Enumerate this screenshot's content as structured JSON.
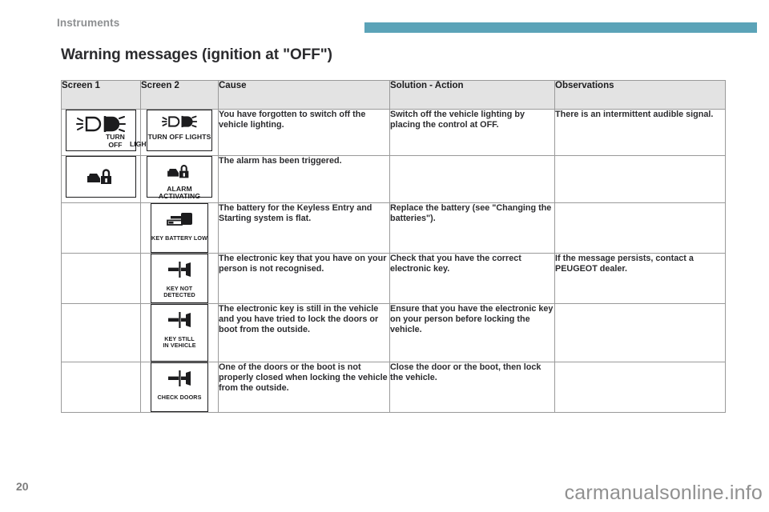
{
  "header": {
    "section_label": "Instruments",
    "accent_color": "#5ba3b8"
  },
  "page_title": "Warning messages (ignition at \"OFF\")",
  "table": {
    "columns": [
      "Screen 1",
      "Screen 2",
      "Cause",
      "Solution - Action",
      "Observations"
    ],
    "rows": [
      {
        "screen1": {
          "icon": "headlights-icon",
          "label_part1": "TURN OFF",
          "label_part2": "LIGHTS"
        },
        "screen2": {
          "icon": "headlights-icon",
          "label": "TURN OFF LIGHTS"
        },
        "cause": "You have forgotten to switch off the vehicle lighting.",
        "solution": "Switch off the vehicle lighting by placing the control at OFF.",
        "observations": "There is an intermittent audible signal."
      },
      {
        "screen1": {
          "icon": "alarm-car-padlock-icon",
          "label": ""
        },
        "screen2": {
          "icon": "alarm-car-padlock-icon",
          "label": "ALARM ACTIVATING"
        },
        "cause": "The alarm has been triggered.",
        "solution": "",
        "observations": ""
      },
      {
        "screen1": null,
        "screen2": {
          "icon": "key-battery-icon",
          "label": "KEY BATTERY LOW"
        },
        "cause": "The battery for the Keyless Entry and Starting system is flat.",
        "solution": "Replace the battery (see \"Changing the batteries\").",
        "observations": ""
      },
      {
        "screen1": null,
        "screen2": {
          "icon": "electronic-key-icon",
          "label": "KEY NOT DETECTED"
        },
        "cause": "The electronic key that you have on your person is not recognised.",
        "solution": "Check that you have the correct electronic key.",
        "observations": "If the message persists, contact a PEUGEOT dealer."
      },
      {
        "screen1": null,
        "screen2": {
          "icon": "electronic-key-icon",
          "label_line1": "KEY STILL",
          "label_line2": "IN VEHICLE"
        },
        "cause": "The electronic key is still in the vehicle and you have tried to lock the doors or boot from the outside.",
        "solution": "Ensure that you have the electronic key on your person before locking the vehicle.",
        "observations": ""
      },
      {
        "screen1": null,
        "screen2": {
          "icon": "electronic-key-icon",
          "label": "CHECK DOORS"
        },
        "cause": "One of the doors or the boot is not properly closed when locking the vehicle from the outside.",
        "solution": "Close the door or the boot, then lock the vehicle.",
        "observations": ""
      }
    ]
  },
  "footer": {
    "page_number": "20",
    "watermark": "carmanualsonline.info"
  }
}
